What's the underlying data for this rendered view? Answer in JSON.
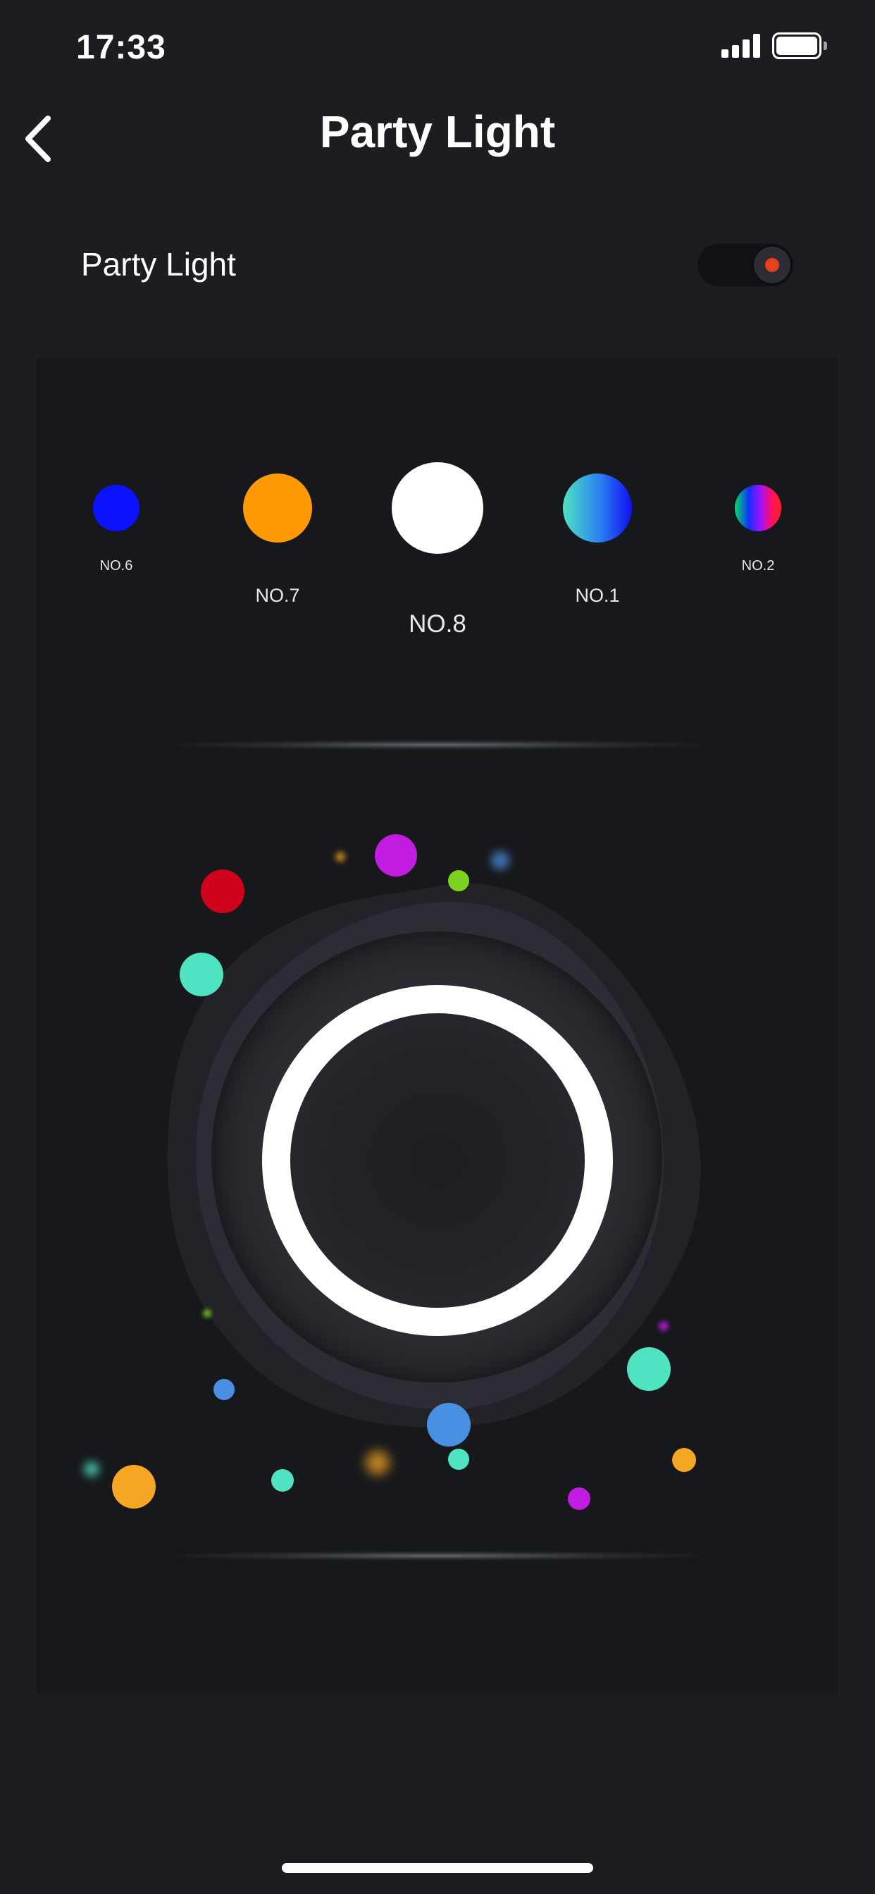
{
  "status_bar": {
    "time": "17:33"
  },
  "nav": {
    "title": "Party Light",
    "back_icon": "chevron-left-icon"
  },
  "party_toggle": {
    "label": "Party Light",
    "on": true,
    "accent_color": "#e8401f"
  },
  "effects": [
    {
      "label": "NO.6",
      "color": "#0a12ff",
      "selected": false
    },
    {
      "label": "NO.7",
      "color": "#ff9a05",
      "selected": false
    },
    {
      "label": "NO.8",
      "color": "#ffffff",
      "selected": true
    },
    {
      "label": "NO.1",
      "color": "gradient-teal-blue",
      "selected": false
    },
    {
      "label": "NO.2",
      "color": "gradient-rainbow",
      "selected": false
    }
  ],
  "particle_colors": [
    "#d0021b",
    "#c21ce0",
    "#7ed321",
    "#4a90e2",
    "#50e3c2",
    "#f5a623"
  ],
  "ring_color": "#ffffff"
}
